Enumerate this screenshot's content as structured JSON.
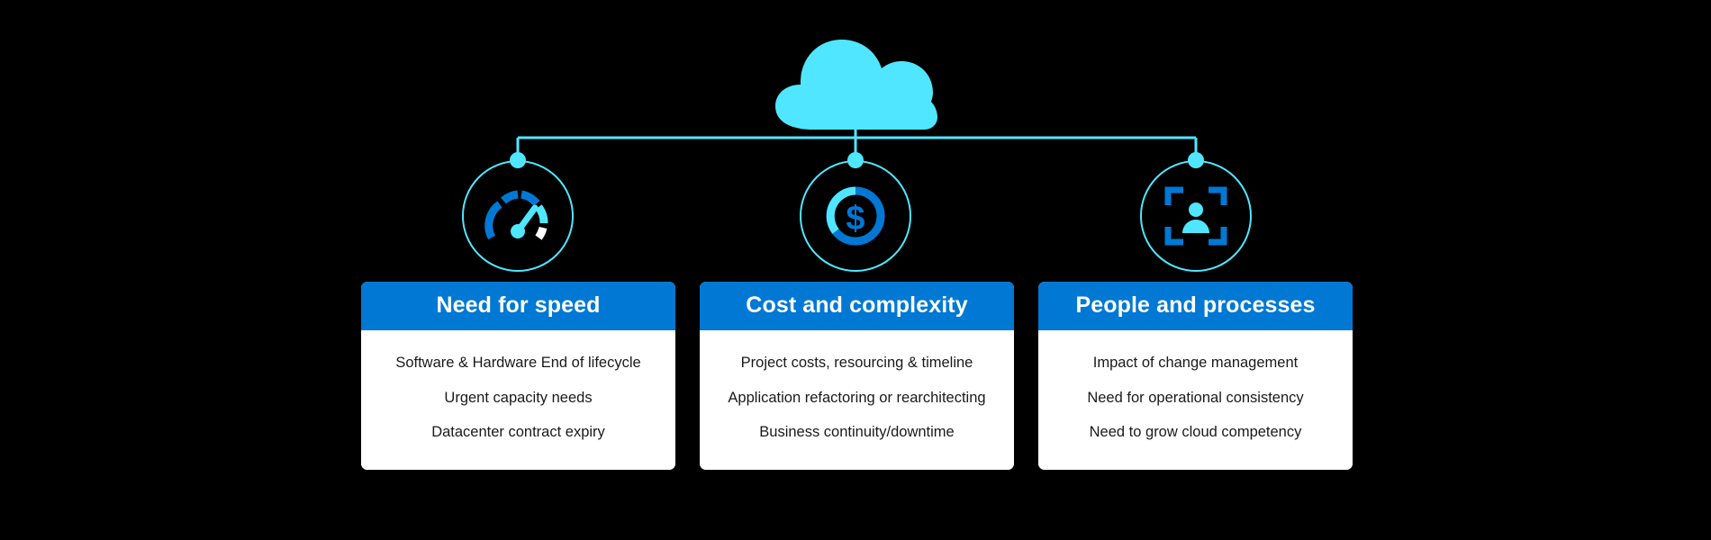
{
  "theme": {
    "background": "#000000",
    "accent_light": "#50E6FF",
    "accent_blue": "#0078D4",
    "card_background": "#FFFFFF",
    "card_text": "#1A1A1A",
    "header_text": "#FFFFFF"
  },
  "diagram": {
    "root": {
      "icon": "cloud-icon"
    },
    "branches": [
      {
        "icon": "speedometer-icon",
        "title": "Need for speed",
        "items": [
          "Software & Hardware End of lifecycle",
          "Urgent capacity needs",
          "Datacenter contract expiry"
        ]
      },
      {
        "icon": "dollar-circle-icon",
        "title": "Cost and complexity",
        "items": [
          "Project costs, resourcing & timeline",
          "Application refactoring or rearchitecting",
          "Business continuity/downtime"
        ]
      },
      {
        "icon": "person-focus-icon",
        "title": "People and processes",
        "items": [
          "Impact of change management",
          "Need for operational consistency",
          "Need to grow cloud competency"
        ]
      }
    ]
  }
}
